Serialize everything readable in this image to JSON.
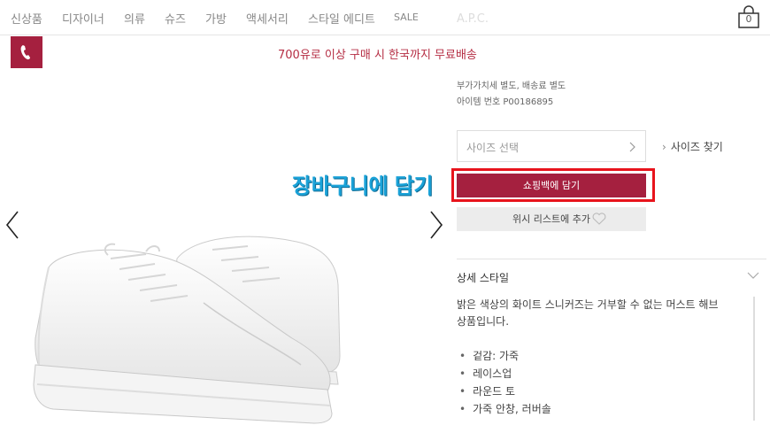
{
  "nav": {
    "items": [
      "신상품",
      "디자이너",
      "의류",
      "슈즈",
      "가방",
      "액세서리",
      "스타일 에디트",
      "SALE"
    ],
    "bag_count": "0"
  },
  "promo": "700유로 이상 구매 시 한국까지 무료배송",
  "product": {
    "tax_note": "부가가치세 별도, 배송료 별도",
    "item_number": "아이템 번호 P00186895",
    "size_placeholder": "사이즈 선택",
    "size_finder": "사이즈 찾기",
    "add_to_bag": "쇼핑백에 담기",
    "wishlist": "위시 리스트에 추가"
  },
  "annotation": "장바구니에 담기",
  "details": {
    "title": "상세 스타일",
    "description": "밝은 색상의 화이트 스니커즈는 거부할 수 없는 머스트 해브 상품입니다.",
    "bullets": [
      "겉감: 가죽",
      "레이스업",
      "라운드 토",
      "가죽 안창, 러버솔"
    ]
  },
  "colors": {
    "brand": "#a5203f",
    "promo": "#b52d43",
    "annotation": "#1aa2d8",
    "highlight": "#e8141c"
  },
  "icons": [
    "phone-icon",
    "shopping-bag-icon",
    "chevron-right-icon",
    "chevron-down-icon",
    "heart-icon",
    "arrow-left-icon",
    "arrow-right-icon"
  ]
}
